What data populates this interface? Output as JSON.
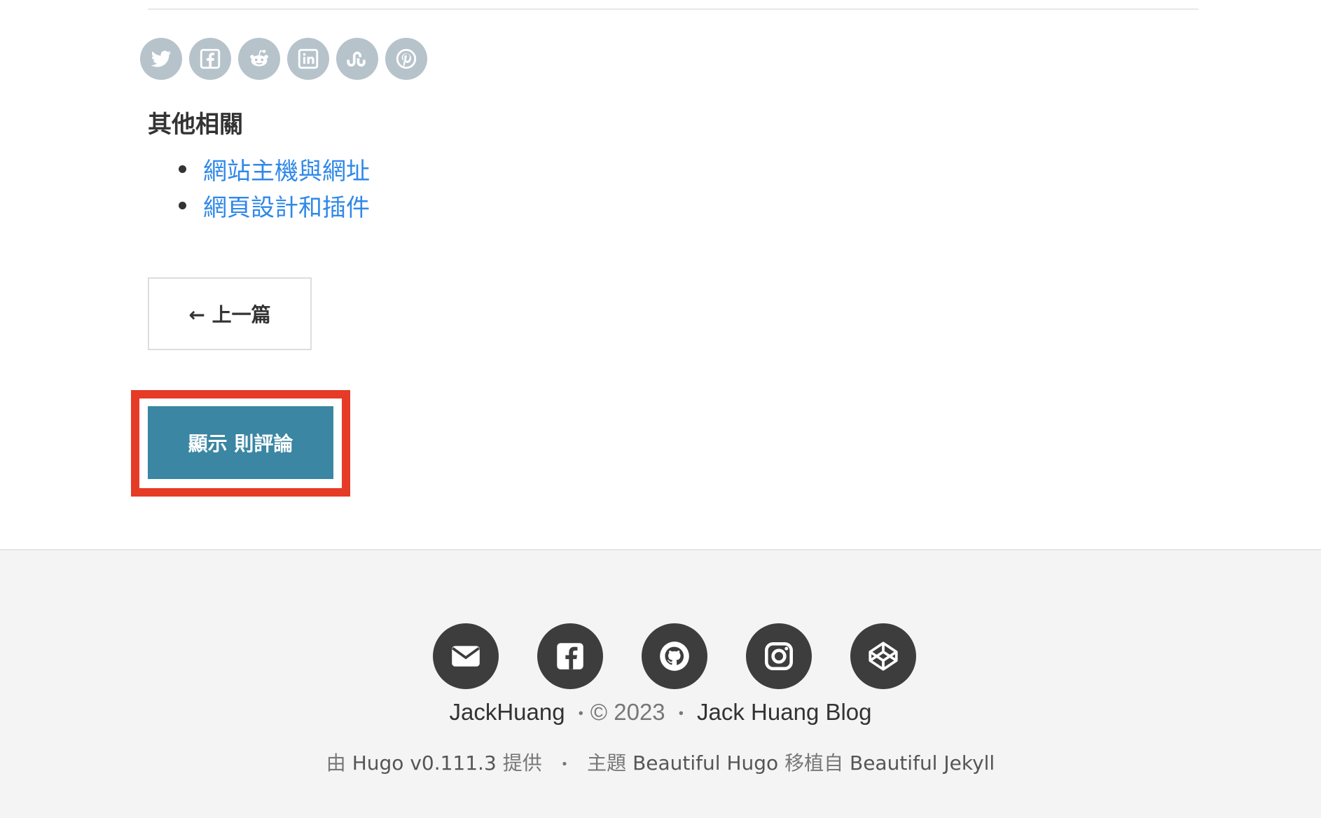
{
  "related": {
    "title": "其他相關",
    "items": [
      {
        "label": "網站主機與網址"
      },
      {
        "label": "網頁設計和插件"
      }
    ]
  },
  "share_icons": [
    "twitter-icon",
    "facebook-icon",
    "reddit-icon",
    "linkedin-icon",
    "stumbleupon-icon",
    "pinterest-icon"
  ],
  "pager": {
    "prev_label": "← 上一篇"
  },
  "comments": {
    "button_label": "顯示 則評論"
  },
  "footer": {
    "social_icons": [
      "email-icon",
      "facebook-icon",
      "github-icon",
      "instagram-icon",
      "codepen-icon"
    ],
    "author": "JackHuang",
    "copyright": "© 2023",
    "blog_title": "Jack Huang Blog",
    "separator": "•",
    "powered_prefix": "由",
    "powered_by": "Hugo v0.111.3",
    "powered_suffix": "提供",
    "theme_prefix": "主題",
    "theme_name": "Beautiful Hugo",
    "ported_label": "移植自",
    "ported_from": "Beautiful Jekyll"
  },
  "colors": {
    "share_bg": "#b7c3cb",
    "link": "#2f88e8",
    "comments_button": "#3a86a3",
    "highlight": "#e53b27",
    "footer_bg": "#f4f4f4",
    "footer_icon_bg": "#3d3d3d"
  }
}
